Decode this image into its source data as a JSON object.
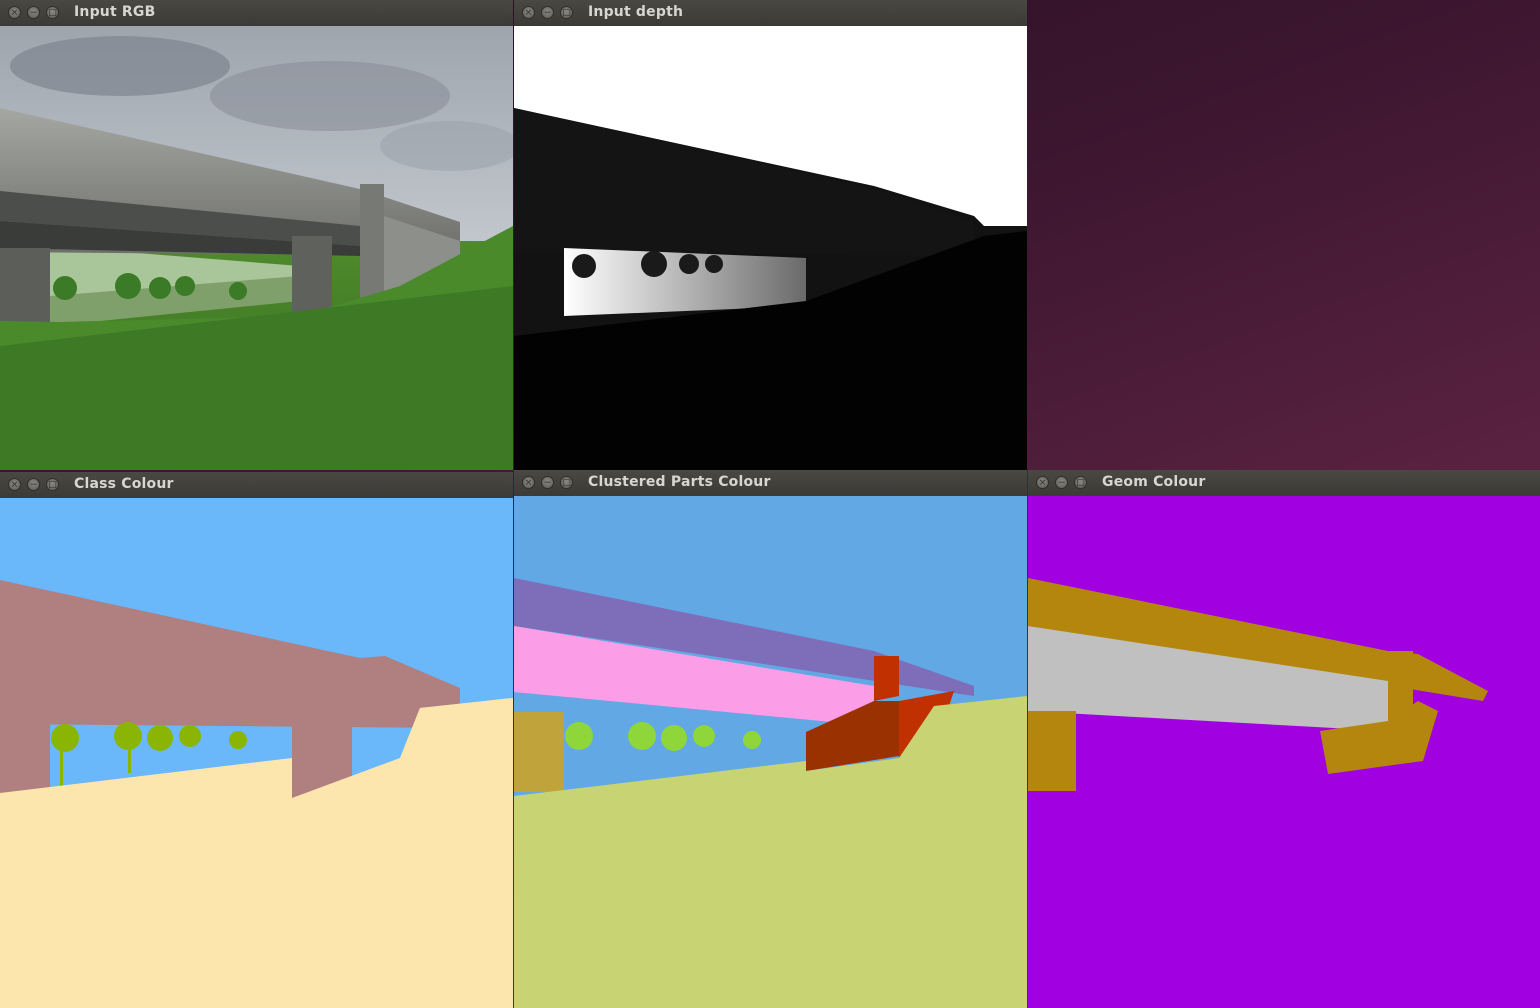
{
  "windows": [
    {
      "id": "input-rgb",
      "title": "Input RGB"
    },
    {
      "id": "input-depth",
      "title": "Input depth"
    },
    {
      "id": "class-colour",
      "title": "Class Colour"
    },
    {
      "id": "clustered-parts-colour",
      "title": "Clustered Parts Colour"
    },
    {
      "id": "geom-colour",
      "title": "Geom Colour"
    }
  ],
  "window_controls": {
    "close": "×",
    "minimize": "−",
    "maximize": "□"
  },
  "colors": {
    "desktop_background": "#5e2443",
    "sky_class": "#6ab7fa",
    "bridge_class": "#b07f7f",
    "ground_class": "#fde6ae",
    "tree_class": "#8bb504",
    "sky_parts": "#62a8e4",
    "deck_top_parts": "#7e6db8",
    "deck_side_parts": "#fc9de8",
    "ground_parts": "#c8d473",
    "pier_parts": "#9a3100",
    "abutment_parts": "#c0a33b",
    "geom_background": "#a100e0",
    "geom_surface": "#b4860e",
    "geom_plane": "#c0c0c0"
  }
}
